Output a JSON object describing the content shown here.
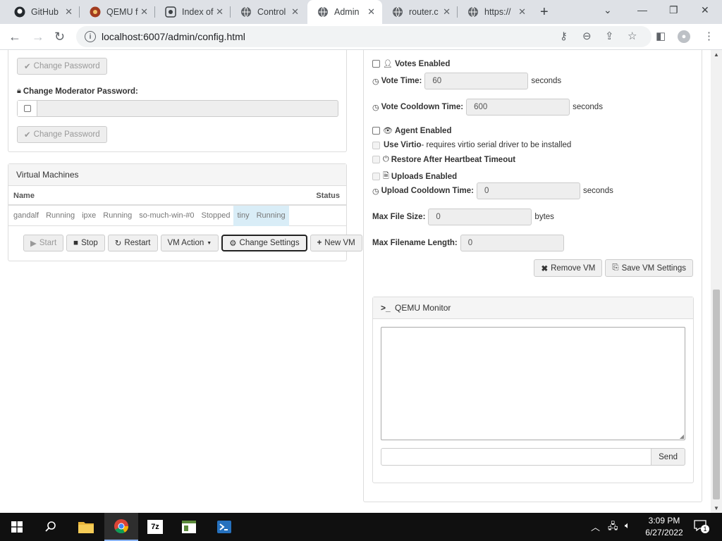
{
  "tabs": [
    {
      "label": "GitHub",
      "icon": "github-icon"
    },
    {
      "label": "QEMU f",
      "icon": "qemu-icon"
    },
    {
      "label": "Index of",
      "icon": "index-icon"
    },
    {
      "label": "Control",
      "icon": "globe-icon"
    },
    {
      "label": "Admin",
      "icon": "globe-icon"
    },
    {
      "label": "router.c",
      "icon": "globe-icon"
    },
    {
      "label": "https://",
      "icon": "globe-icon"
    }
  ],
  "toolbar": {
    "url": "localhost:6007/admin/config.html"
  },
  "left": {
    "change_password_btn_1": "Change Password",
    "moderator_label": "Change Moderator Password:",
    "change_password_btn_2": "Change Password"
  },
  "vms": {
    "title": "Virtual Machines",
    "col_name": "Name",
    "col_status": "Status",
    "rows": [
      {
        "name": "gandalf",
        "status": "Running"
      },
      {
        "name": "ipxe",
        "status": "Running"
      },
      {
        "name": "so-much-win-#0",
        "status": "Stopped"
      },
      {
        "name": "tiny",
        "status": "Running"
      }
    ],
    "buttons": {
      "start": "Start",
      "stop": "Stop",
      "restart": "Restart",
      "vm_action": "VM Action",
      "change_settings": "Change Settings",
      "new_vm": "New VM"
    }
  },
  "settings": {
    "votes_enabled": "Votes Enabled",
    "vote_time_label": "Vote Time:",
    "vote_time_value": "60",
    "vote_cooldown_label": "Vote Cooldown Time:",
    "vote_cooldown_value": "600",
    "seconds": "seconds",
    "agent_enabled": "Agent Enabled",
    "use_virtio": "Use Virtio",
    "use_virtio_note": " - requires virtio serial driver to be installed",
    "restore_after_heartbeat": "Restore After Heartbeat Timeout",
    "uploads_enabled": "Uploads Enabled",
    "upload_cooldown_label": "Upload Cooldown Time:",
    "upload_cooldown_value": "0",
    "max_file_size_label": "Max File Size:",
    "max_file_size_value": "0",
    "bytes": "bytes",
    "max_filename_label": "Max Filename Length:",
    "max_filename_value": "0",
    "remove_vm": "Remove VM",
    "save_vm_settings": "Save VM Settings"
  },
  "monitor": {
    "title": "QEMU Monitor",
    "send": "Send"
  },
  "taskbar": {
    "time": "3:09 PM",
    "date": "6/27/2022",
    "notification_count": "1"
  },
  "colors": {
    "selected_row": "#d9edf7",
    "taskbar": "#101010",
    "chrome_tabstrip": "#dee1e6"
  }
}
